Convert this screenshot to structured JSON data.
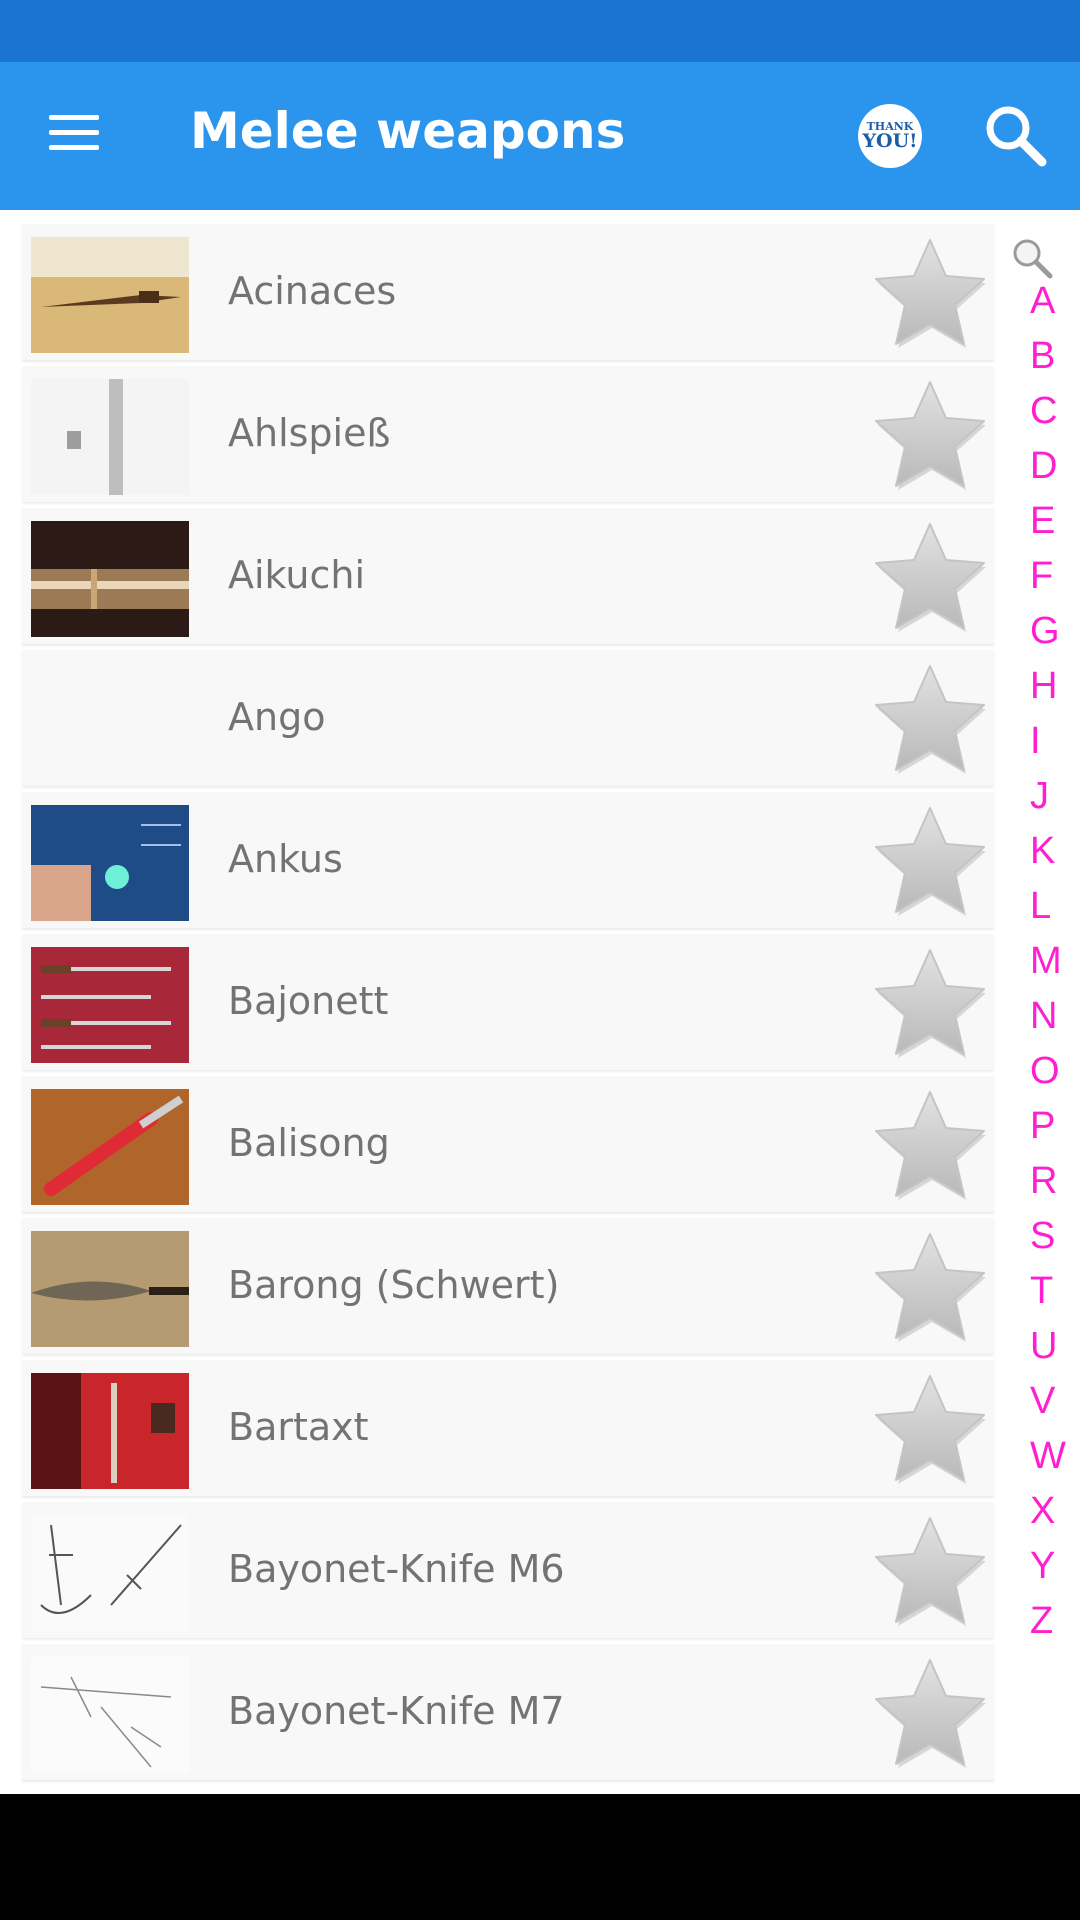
{
  "app_bar": {
    "title": "Melee weapons",
    "thanks_line1": "THANK",
    "thanks_line2": "YOU!"
  },
  "items": [
    {
      "label": "Acinaces",
      "thumb": "museum-dagger"
    },
    {
      "label": "Ahlspieß",
      "thumb": "blurry-spike"
    },
    {
      "label": "Aikuchi",
      "thumb": "dark-blade"
    },
    {
      "label": "Ango",
      "thumb": "none"
    },
    {
      "label": "Ankus",
      "thumb": "blue-tech"
    },
    {
      "label": "Bajonett",
      "thumb": "bayonets-red"
    },
    {
      "label": "Balisong",
      "thumb": "red-butterfly-knife"
    },
    {
      "label": "Barong (Schwert)",
      "thumb": "leaf-blade"
    },
    {
      "label": "Bartaxt",
      "thumb": "red-display"
    },
    {
      "label": "Bayonet-Knife M6",
      "thumb": "sketch"
    },
    {
      "label": "Bayonet-Knife M7",
      "thumb": "sketch-light"
    }
  ],
  "alphabet_index": [
    "A",
    "B",
    "C",
    "D",
    "E",
    "F",
    "G",
    "H",
    "I",
    "J",
    "K",
    "L",
    "M",
    "N",
    "O",
    "P",
    "R",
    "S",
    "T",
    "U",
    "V",
    "W",
    "X",
    "Y",
    "Z"
  ],
  "colors": {
    "app_bar": "#2b95ee",
    "status_bar": "#1b74d0",
    "index_letters": "#ff1fd0",
    "label_text": "#737373"
  },
  "icons": [
    "menu-icon",
    "thank-you-icon",
    "search-icon",
    "star-icon",
    "magnifier-icon"
  ]
}
